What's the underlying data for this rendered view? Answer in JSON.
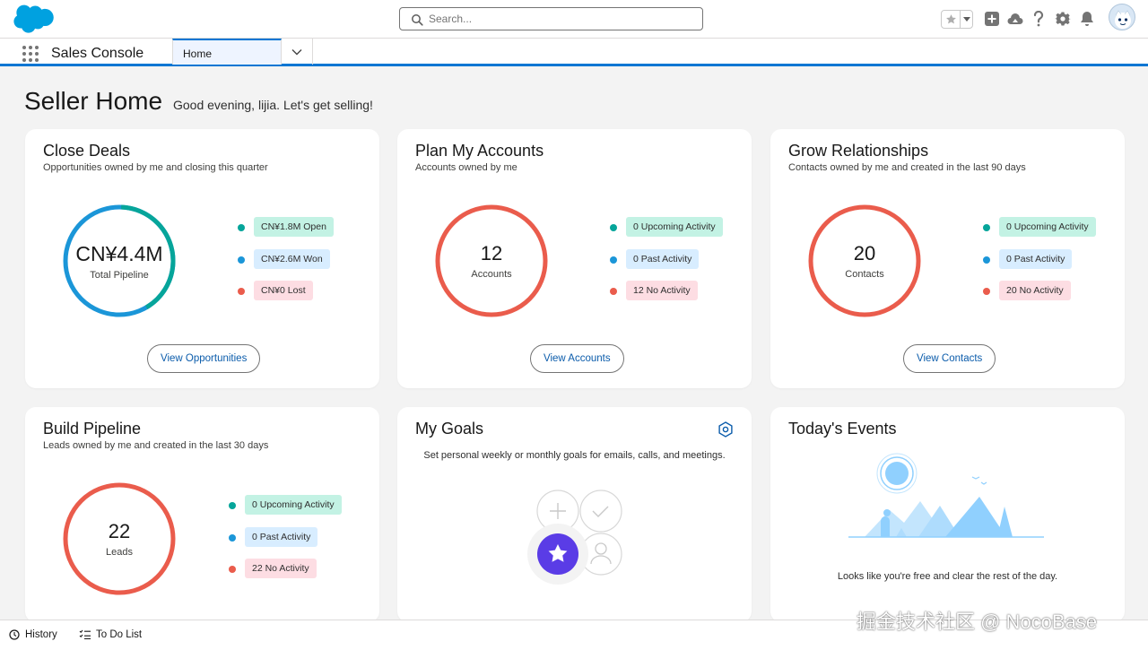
{
  "header": {
    "search_placeholder": "Search...",
    "icons": [
      "favorites-star-icon",
      "add-icon",
      "trailhead-icon",
      "help-icon",
      "setup-gear-icon",
      "notifications-bell-icon",
      "user-avatar"
    ]
  },
  "nav": {
    "app_name": "Sales Console",
    "tab_label": "Home"
  },
  "page": {
    "title": "Seller Home",
    "greeting": "Good evening, lijia. Let's get selling!"
  },
  "cards": {
    "close_deals": {
      "title": "Close Deals",
      "subtitle": "Opportunities owned by me and closing this quarter",
      "center_value": "CN¥4.4M",
      "center_label": "Total Pipeline",
      "legend": [
        "CN¥1.8M Open",
        "CN¥2.6M Won",
        "CN¥0 Lost"
      ],
      "ring_open_fraction": 0.41,
      "button": "View Opportunities"
    },
    "plan_accounts": {
      "title": "Plan My Accounts",
      "subtitle": "Accounts owned by me",
      "center_value": "12",
      "center_label": "Accounts",
      "legend": [
        "0 Upcoming Activity",
        "0 Past Activity",
        "12 No Activity"
      ],
      "button": "View Accounts"
    },
    "grow_relationships": {
      "title": "Grow Relationships",
      "subtitle": "Contacts owned by me and created in the last 90 days",
      "center_value": "20",
      "center_label": "Contacts",
      "legend": [
        "0 Upcoming Activity",
        "0 Past Activity",
        "20 No Activity"
      ],
      "button": "View Contacts"
    },
    "build_pipeline": {
      "title": "Build Pipeline",
      "subtitle": "Leads owned by me and created in the last 30 days",
      "center_value": "22",
      "center_label": "Leads",
      "legend": [
        "0 Upcoming Activity",
        "0 Past Activity",
        "22 No Activity"
      ]
    },
    "my_goals": {
      "title": "My Goals",
      "text": "Set personal weekly or monthly goals for emails, calls, and meetings."
    },
    "todays_events": {
      "title": "Today's Events",
      "text": "Looks like you're free and clear the rest of the day."
    }
  },
  "colors": {
    "teal": "#06a59a",
    "blue": "#1b96d8",
    "red": "#ea5c4c",
    "brand": "#0176d3"
  },
  "utility_bar": {
    "history": "History",
    "todo": "To Do List"
  },
  "watermark": "掘金技术社区 @ NocoBase"
}
